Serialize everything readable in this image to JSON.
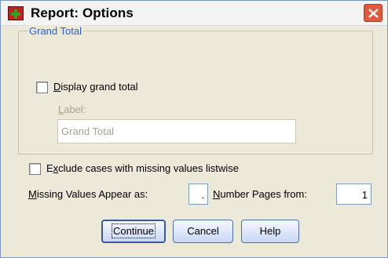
{
  "window": {
    "title": "Report: Options",
    "icon": "spss-report-icon",
    "close": "close-icon"
  },
  "grand_total_group": {
    "legend": "Grand Total",
    "display_checkbox": {
      "label_pre": "",
      "label_key": "D",
      "label_post": "isplay grand total",
      "checked": false
    },
    "label_field": {
      "label_key": "L",
      "label_post": "abel:",
      "value": "Grand Total",
      "enabled": false
    }
  },
  "exclude_checkbox": {
    "label_pre": "E",
    "label_key": "x",
    "label_post": "clude cases with missing values listwise",
    "checked": false
  },
  "missing_values": {
    "label_key": "M",
    "label_post": "issing Values Appear as:",
    "value": "."
  },
  "number_pages": {
    "label_key": "N",
    "label_post": "umber Pages from:",
    "value": "1"
  },
  "buttons": {
    "continue": "Continue",
    "cancel": "Cancel",
    "help": "Help"
  },
  "colors": {
    "legend": "#245edb",
    "face": "#ece9d8",
    "close": "#e15a3c"
  }
}
